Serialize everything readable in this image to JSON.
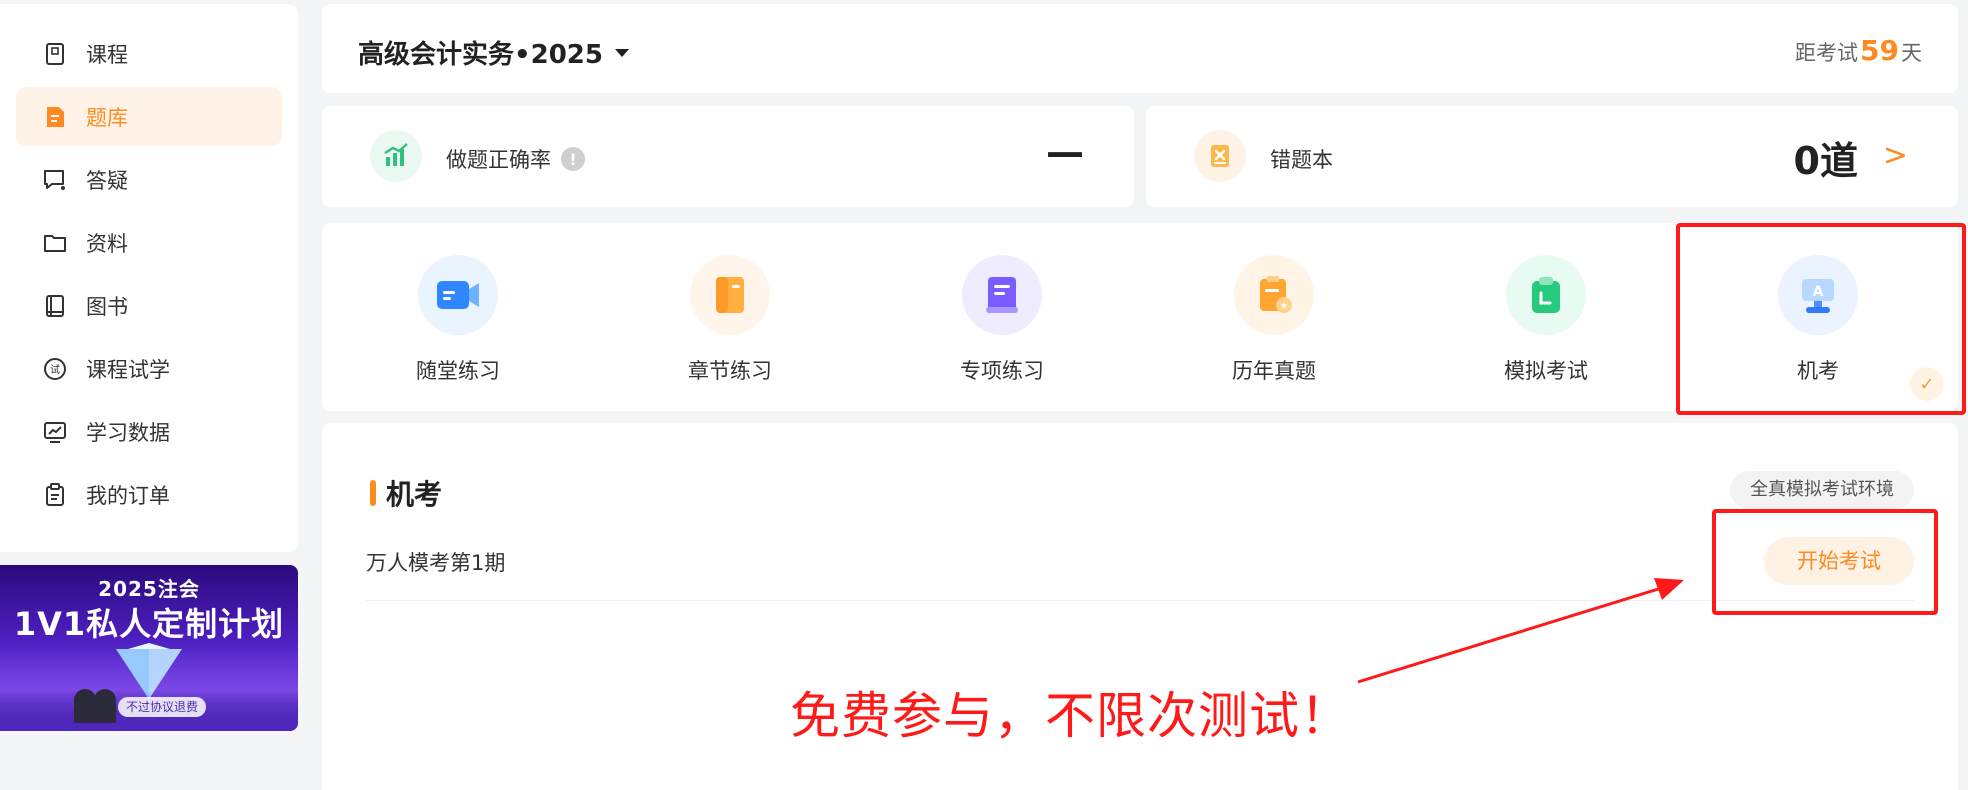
{
  "sidebar": {
    "items": [
      {
        "label": "课程",
        "icon": "course-icon",
        "active": false
      },
      {
        "label": "题库",
        "icon": "question-bank-icon",
        "active": true
      },
      {
        "label": "答疑",
        "icon": "qa-icon",
        "active": false
      },
      {
        "label": "资料",
        "icon": "folder-icon",
        "active": false
      },
      {
        "label": "图书",
        "icon": "book-icon",
        "active": false
      },
      {
        "label": "课程试学",
        "icon": "trial-icon",
        "active": false
      },
      {
        "label": "学习数据",
        "icon": "data-chart-icon",
        "active": false
      },
      {
        "label": "我的订单",
        "icon": "clipboard-icon",
        "active": false
      }
    ]
  },
  "banner": {
    "year_text": "2025注会",
    "title": "1V1私人定制计划",
    "tag": "不过协议退费"
  },
  "header": {
    "course_title": "高级会计实务•2025",
    "countdown_prefix": "距考试",
    "countdown_days": "59",
    "countdown_suffix": "天"
  },
  "stats": {
    "accuracy_label": "做题正确率",
    "accuracy_value": "—",
    "wrong_book_label": "错题本",
    "wrong_book_value": "0道"
  },
  "modes": [
    {
      "label": "随堂练习",
      "icon": "video-practice-icon"
    },
    {
      "label": "章节练习",
      "icon": "chapter-book-icon"
    },
    {
      "label": "专项练习",
      "icon": "special-doc-icon"
    },
    {
      "label": "历年真题",
      "icon": "past-exam-icon"
    },
    {
      "label": "模拟考试",
      "icon": "mock-exam-icon"
    },
    {
      "label": "机考",
      "icon": "computer-exam-icon",
      "selected": true
    }
  ],
  "exam_section": {
    "title": "机考",
    "env_tag": "全真模拟考试环境",
    "exams": [
      {
        "name": "万人模考第1期",
        "button": "开始考试"
      }
    ]
  },
  "annotation": {
    "text": "免费参与，不限次测试！"
  },
  "colors": {
    "accent": "#ff8a1f",
    "highlight": "#ff1a1a"
  }
}
